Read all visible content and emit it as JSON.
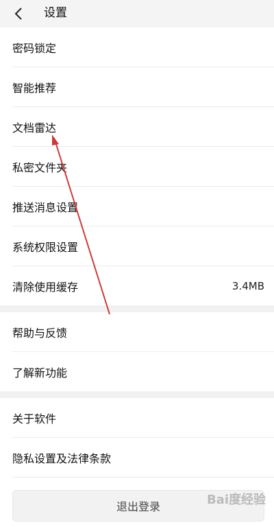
{
  "header": {
    "title": "设置",
    "back_icon": "chevron-left-icon"
  },
  "settings": {
    "group1": [
      {
        "label": "密码锁定"
      },
      {
        "label": "智能推荐"
      },
      {
        "label": "文档雷达"
      },
      {
        "label": "私密文件夹"
      },
      {
        "label": "推送消息设置"
      },
      {
        "label": "系统权限设置"
      },
      {
        "label": "清除使用缓存",
        "value": "3.4MB"
      }
    ],
    "group2": [
      {
        "label": "帮助与反馈"
      },
      {
        "label": "了解新功能"
      }
    ],
    "group3": [
      {
        "label": "关于软件"
      },
      {
        "label": "隐私设置及法律条款"
      }
    ]
  },
  "footer": {
    "logout_label": "退出登录",
    "watermark": "Bai度经验"
  },
  "colors": {
    "accent_arrow": "#cc3b3b",
    "background": "#ffffff",
    "section_gap": "#f1f1f1"
  }
}
